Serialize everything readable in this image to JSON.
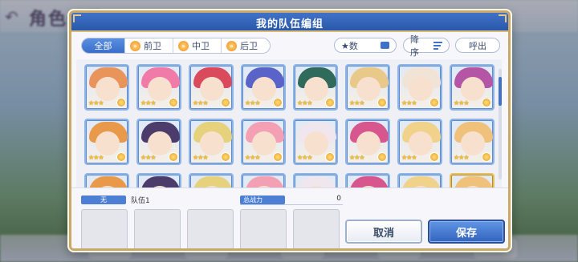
{
  "background": {
    "screen_title": "角色一覧"
  },
  "modal": {
    "title": "我的队伍编组",
    "tabs": [
      {
        "label": "全部",
        "active": true
      },
      {
        "label": "前卫",
        "active": false
      },
      {
        "label": "中卫",
        "active": false
      },
      {
        "label": "后卫",
        "active": false
      }
    ],
    "sort_key_label": "★数",
    "sort_order_label": "降序",
    "call_label": "呼出",
    "roster_row1": [
      {
        "hair": "#e8945a",
        "stars": "★★★"
      },
      {
        "hair": "#f07aa8",
        "stars": "★★★"
      },
      {
        "hair": "#d94a5c",
        "stars": "★★★"
      },
      {
        "hair": "#5a63c8",
        "stars": "★★★"
      },
      {
        "hair": "#2f6a5a",
        "stars": "★★★"
      },
      {
        "hair": "#e9c98a",
        "stars": "★★★"
      },
      {
        "hair": "#f1e4d6",
        "stars": "★★★"
      },
      {
        "hair": "#b455a6",
        "stars": "★★★"
      }
    ],
    "roster_row2": [
      {
        "hair": "#e89a4a",
        "stars": "★★★"
      },
      {
        "hair": "#4b3c6c",
        "stars": "★★★"
      },
      {
        "hair": "#e6d27c",
        "stars": "★★★"
      },
      {
        "hair": "#f3a0b4",
        "stars": "★★★"
      },
      {
        "hair": "#f0e6ee",
        "stars": "★★★"
      },
      {
        "hair": "#d7568e",
        "stars": "★★★"
      },
      {
        "hair": "#f1d28a",
        "stars": "★★★"
      },
      {
        "hair": "#f0c17a",
        "stars": "★★★"
      }
    ],
    "team_position_label": "无",
    "team_name": "队伍1",
    "total_power_label": "总战力",
    "total_power_value": "0",
    "cancel_label": "取消",
    "save_label": "保存"
  },
  "colors": {
    "accent": "#3f72c8",
    "frame_gold": "#c9a86a",
    "star": "#f6c232"
  }
}
